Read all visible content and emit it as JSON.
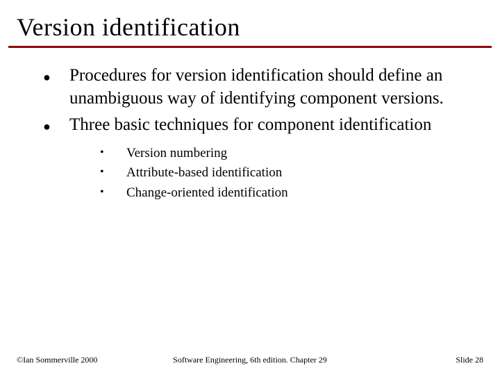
{
  "title": "Version identification",
  "bullets": [
    {
      "marker": "●",
      "text": "Procedures for version identification should define an unambiguous way of identifying component versions."
    },
    {
      "marker": "●",
      "text": "Three basic techniques for component identification"
    }
  ],
  "sub_bullets": [
    {
      "marker": "•",
      "text": "Version numbering"
    },
    {
      "marker": "•",
      "text": "Attribute-based identification"
    },
    {
      "marker": "•",
      "text": "Change-oriented identification"
    }
  ],
  "footer": {
    "left": "©Ian Sommerville 2000",
    "center": "Software Engineering, 6th edition. Chapter 29",
    "right": "Slide 28"
  },
  "colors": {
    "accent": "#8b0010"
  }
}
